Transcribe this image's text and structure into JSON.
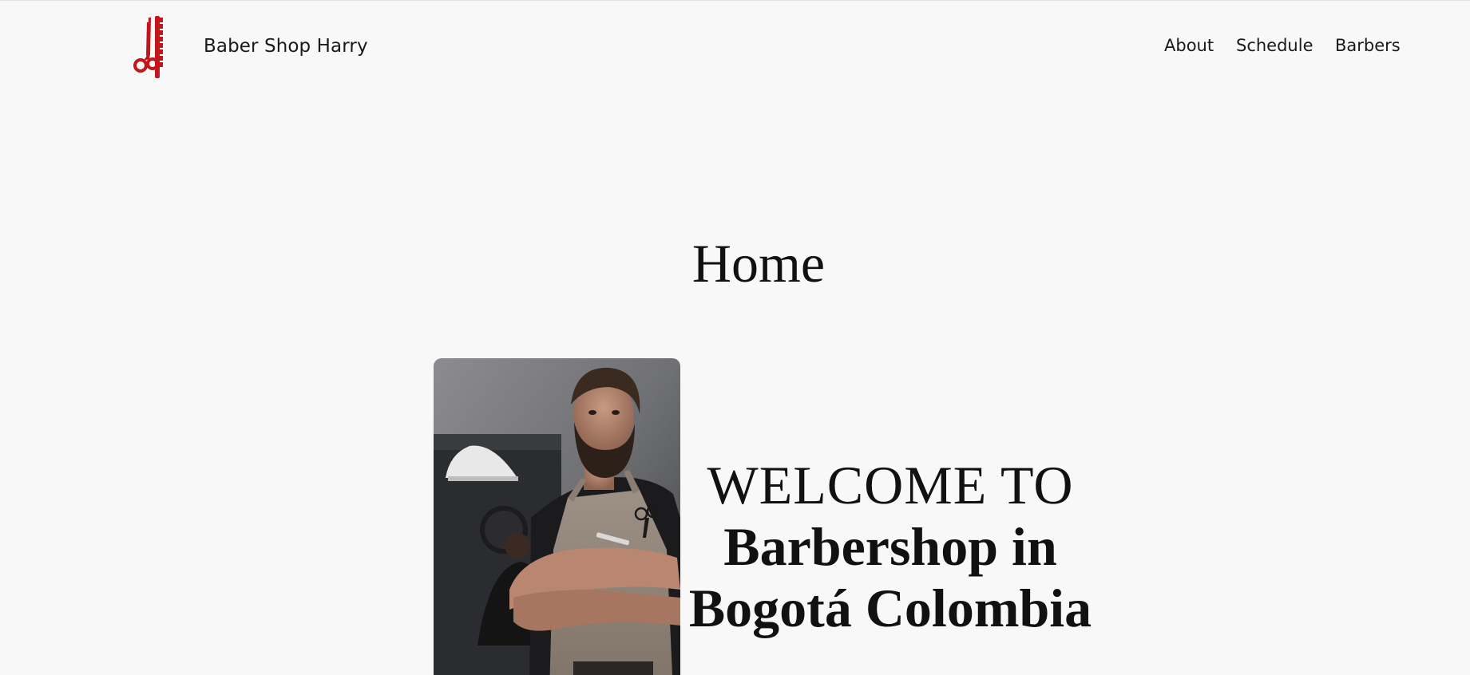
{
  "header": {
    "brand_name": "Baber Shop Harry",
    "logo_icon": "scissors-comb-icon",
    "nav": [
      {
        "label": "About"
      },
      {
        "label": "Schedule"
      },
      {
        "label": "Barbers"
      }
    ]
  },
  "main": {
    "page_title": "Home",
    "hero": {
      "photo_subject": "barber-portrait",
      "welcome_line": "WELCOME TO",
      "headline": "Barbershop in Bogotá Colombia"
    }
  },
  "colors": {
    "background": "#f8f8f8",
    "logo_red": "#c0161c",
    "text": "#111111"
  }
}
